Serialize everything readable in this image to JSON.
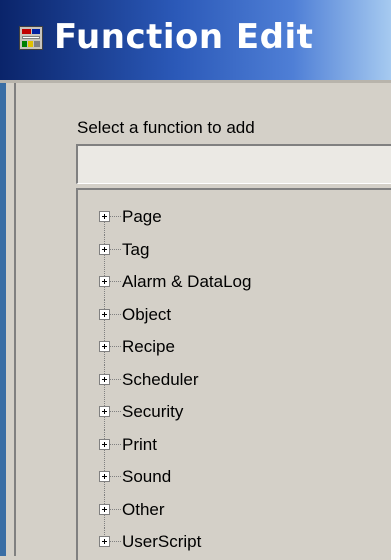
{
  "window": {
    "title": "Function Edit",
    "icon": "form-window-icon"
  },
  "dialog": {
    "prompt": "Select a function to add",
    "search_value": ""
  },
  "tree": {
    "items": [
      {
        "label": "Page",
        "icon": "expand-plus-icon"
      },
      {
        "label": "Tag",
        "icon": "expand-plus-icon"
      },
      {
        "label": "Alarm & DataLog",
        "icon": "expand-plus-icon"
      },
      {
        "label": "Object",
        "icon": "expand-plus-icon"
      },
      {
        "label": "Recipe",
        "icon": "expand-plus-icon"
      },
      {
        "label": "Scheduler",
        "icon": "expand-plus-icon"
      },
      {
        "label": "Security",
        "icon": "expand-plus-icon"
      },
      {
        "label": "Print",
        "icon": "expand-plus-icon"
      },
      {
        "label": "Sound",
        "icon": "expand-plus-icon"
      },
      {
        "label": "Other",
        "icon": "expand-plus-icon"
      },
      {
        "label": "UserScript",
        "icon": "expand-plus-icon"
      }
    ]
  },
  "colors": {
    "titlebar_start": "#0a246a",
    "titlebar_end": "#a6caf0",
    "dialog_bg": "#d4d0c8",
    "title_text": "#ffffff"
  }
}
